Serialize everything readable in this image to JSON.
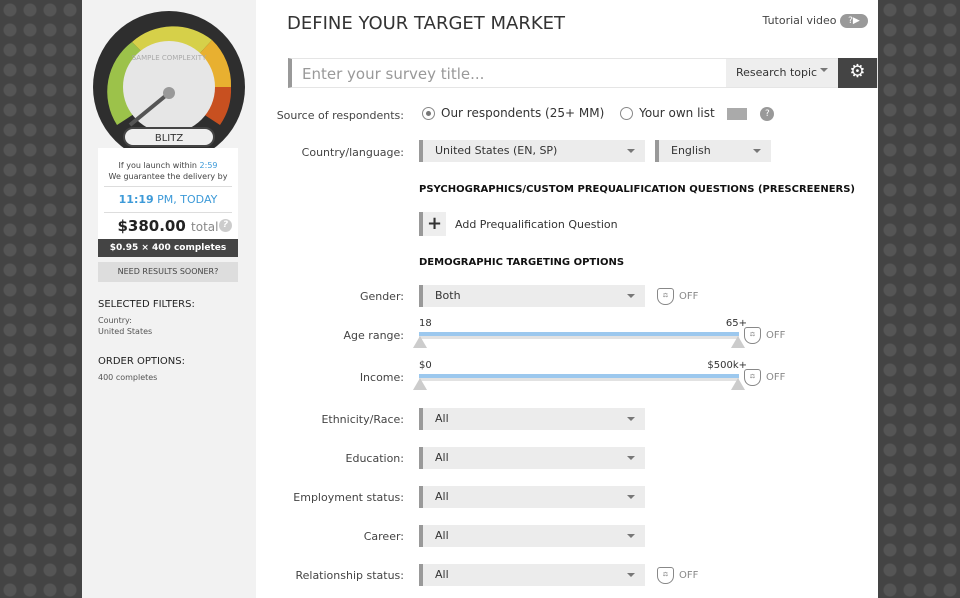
{
  "sidebar": {
    "gauge_label": "SAMPLE COMPLEXITY",
    "gauge_level": "BLITZ",
    "launch_text": "If you launch within",
    "launch_time": "2:59",
    "guarantee": "We guarantee the delivery by",
    "delivery_time": "11:19",
    "delivery_suffix": "PM, TODAY",
    "total": "$380.00",
    "total_label": "total",
    "help": "?",
    "per_unit": "$0.95 × 400 completes",
    "sooner": "NEED RESULTS SOONER?",
    "filters_heading": "SELECTED FILTERS:",
    "filter_key": "Country:",
    "filter_value": "United States",
    "order_heading": "ORDER OPTIONS:",
    "order_value": "400 completes"
  },
  "header": {
    "title": "DEFINE YOUR TARGET MARKET",
    "tutorial": "Tutorial video",
    "tutorial_icon": "?▶"
  },
  "survey": {
    "placeholder": "Enter your survey title...",
    "research_topic": "Research topic",
    "gear": "⚙"
  },
  "source": {
    "label": "Source of respondents:",
    "option1": "Our respondents (25+ MM)",
    "option2": "Your own list",
    "help": "?"
  },
  "country": {
    "label": "Country/language:",
    "country": "United States (EN, SP)",
    "language": "English"
  },
  "prescreen": {
    "heading": "PSYCHOGRAPHICS/CUSTOM PREQUALIFICATION QUESTIONS (PRESCREENERS)",
    "add": "Add Prequalification Question"
  },
  "demo": {
    "heading": "DEMOGRAPHIC TARGETING OPTIONS",
    "off": "OFF",
    "shield": "⚖",
    "gender": {
      "label": "Gender:",
      "value": "Both"
    },
    "age": {
      "label": "Age range:",
      "min": "18",
      "max": "65+",
      "fill_fraction": 1
    },
    "income": {
      "label": "Income:",
      "min": "$0",
      "max": "$500k+",
      "fill_fraction": 1
    },
    "fields": [
      {
        "label": "Ethnicity/Race:",
        "value": "All"
      },
      {
        "label": "Education:",
        "value": "All"
      },
      {
        "label": "Employment status:",
        "value": "All"
      },
      {
        "label": "Career:",
        "value": "All"
      },
      {
        "label": "Relationship status:",
        "value": "All"
      }
    ]
  }
}
